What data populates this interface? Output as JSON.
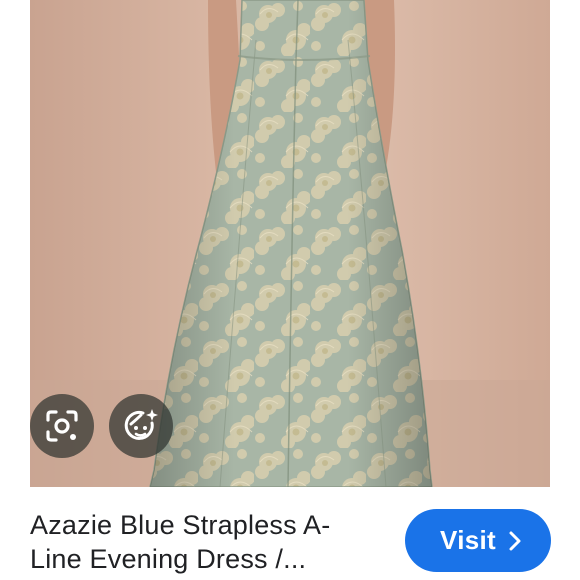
{
  "image": {
    "subject": "dress-photo"
  },
  "actions": {
    "lens_icon": "lens-search-icon",
    "face_icon": "face-sparkle-icon"
  },
  "result": {
    "title_line1": "Azazie Blue Strapless A-",
    "title_line2": "Line Evening Dress /...",
    "visit_label": "Visit",
    "visit_icon": "chevron-right-icon"
  },
  "colors": {
    "accent": "#1a73e8",
    "backdrop": "#d8b6a3",
    "dress": "#a9b7a6",
    "text": "#202124"
  }
}
